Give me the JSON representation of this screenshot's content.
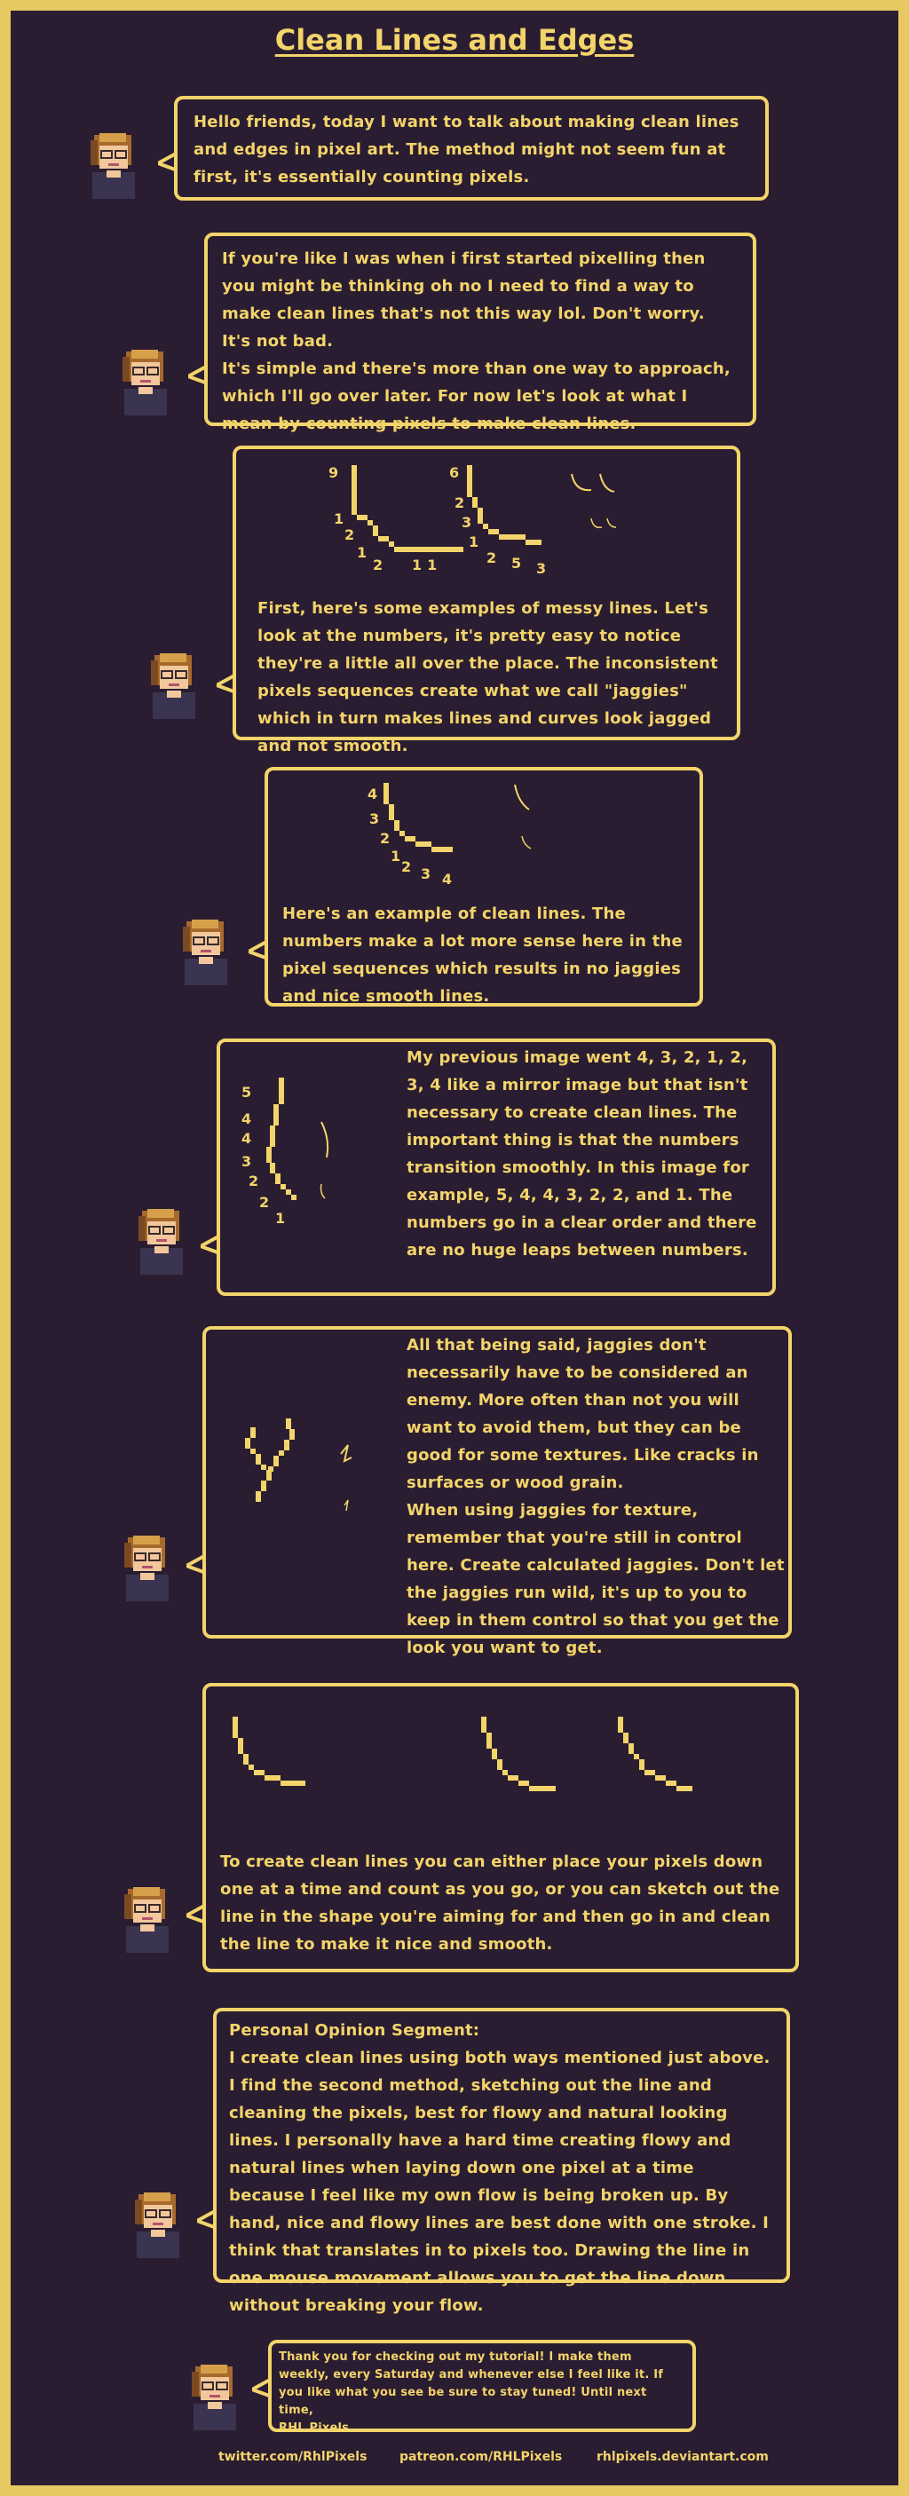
{
  "title": "Clean Lines and Edges",
  "sections": {
    "s1": "Hello friends, today I want to talk about making clean lines and edges in pixel art. The method might not seem fun at first, it's essentially counting pixels.",
    "s2": "If you're like I was when i first started pixelling then you might be thinking oh no I need to find a way to make clean lines that's not this way lol. Don't worry. It's not bad.\nIt's simple and there's more than one way to approach, which I'll go over later. For now let's look at what I mean by counting pixels to make clean lines.",
    "s3": "First, here's some examples of messy lines. Let's look at the numbers, it's pretty easy to notice they're a little all over the place. The inconsistent pixels sequences create what we call \"jaggies\" which in turn makes lines and curves look jagged and not smooth.",
    "s4": "Here's an example of clean lines. The numbers make a lot more sense here in the pixel sequences which results in no jaggies and nice smooth lines.",
    "s5": "My previous image went 4, 3, 2, 1, 2, 3, 4 like a mirror image but that isn't necessary to create clean lines. The important thing is that the numbers transition smoothly. In this image for example, 5, 4, 4, 3, 2, 2, and 1. The numbers go in a clear order and there are no huge leaps between numbers.",
    "s6": "All that being said, jaggies don't necessarily have to be considered an enemy. More often than not you will want to avoid them, but they can be good for some textures. Like cracks in surfaces or wood grain.\nWhen using jaggies for texture, remember that you're still in control here. Create calculated jaggies. Don't let the jaggies run wild, it's up to you to keep in them control so that you get the look you want to get.",
    "s7": "To create clean lines you can either place your pixels down one at a time and count as you go, or you can sketch out the line in the shape you're aiming for and then go in and clean the line to make it nice and smooth.",
    "s8_heading": "Personal Opinion Segment:",
    "s8": "I create clean lines using both ways mentioned just above. I find the second method, sketching out the line and cleaning the pixels, best for flowy and natural looking lines. I personally have a hard time creating flowy and natural lines when laying down one pixel at a time because I feel like my own flow is being broken up. By hand, nice and flowy lines are best done with one stroke. I think that translates in to pixels too. Drawing the line in one mouse movement allows you to get the line down without breaking your flow.",
    "s9": "Thank you for checking out my tutorial! I make them weekly, every Saturday and whenever else I feel like it. If you like what you see be sure to stay tuned! Until next time,\nRHL Pixels"
  },
  "labels": {
    "messy_a": [
      "9",
      "1",
      "2",
      "1",
      "2",
      "1 1"
    ],
    "messy_b": [
      "6",
      "2",
      "3",
      "1",
      "2",
      "5",
      "3"
    ],
    "clean_a": [
      "4",
      "3",
      "2",
      "1",
      "2",
      "3",
      "4"
    ],
    "clean_b": [
      "5",
      "4",
      "4",
      "3",
      "2",
      "2",
      "1"
    ]
  },
  "footer": {
    "twitter": "twitter.com/RhlPixels",
    "patreon": "patreon.com/RHLPixels",
    "deviantart": "rhlpixels.deviantart.com"
  },
  "colors": {
    "accent": "#f3d46a",
    "background": "#2a1d31",
    "border": "#e8c961"
  }
}
